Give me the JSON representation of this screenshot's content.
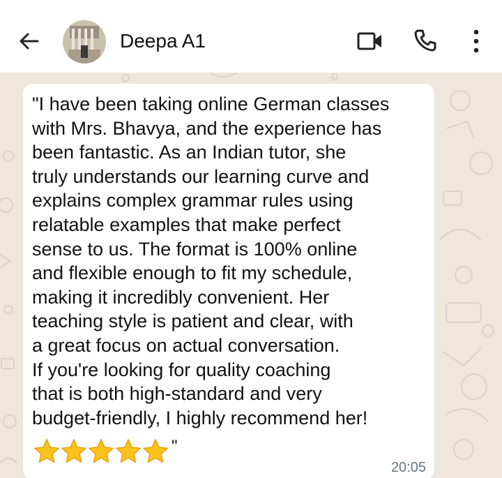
{
  "header": {
    "contact_name": "Deepa A1",
    "icons": {
      "back": "back-arrow-icon",
      "video": "video-call-icon",
      "call": "phone-call-icon",
      "menu": "more-vertical-icon"
    }
  },
  "message": {
    "text": "\"I have been taking online German classes\nwith Mrs. Bhavya, and the experience has\nbeen fantastic. As an Indian tutor, she\ntruly understands our learning curve and\nexplains complex grammar rules using\nrelatable examples that make perfect\nsense to us. The format is 100% online\nand flexible enough to fit my schedule,\nmaking it incredibly convenient. Her\nteaching style is patient and clear, with\na great focus on actual conversation.\nIf you're looking for quality coaching\nthat is both high-standard and very\nbudget-friendly, I highly recommend her!",
    "rating": 5,
    "rating_max": 5,
    "closing_quote": "\"",
    "time": "20:05"
  },
  "colors": {
    "chat_background": "#efe7de",
    "bubble": "#ffffff",
    "star_fill": "#fcc21b",
    "star_stroke": "#e59e0b",
    "timestamp": "#667781"
  }
}
